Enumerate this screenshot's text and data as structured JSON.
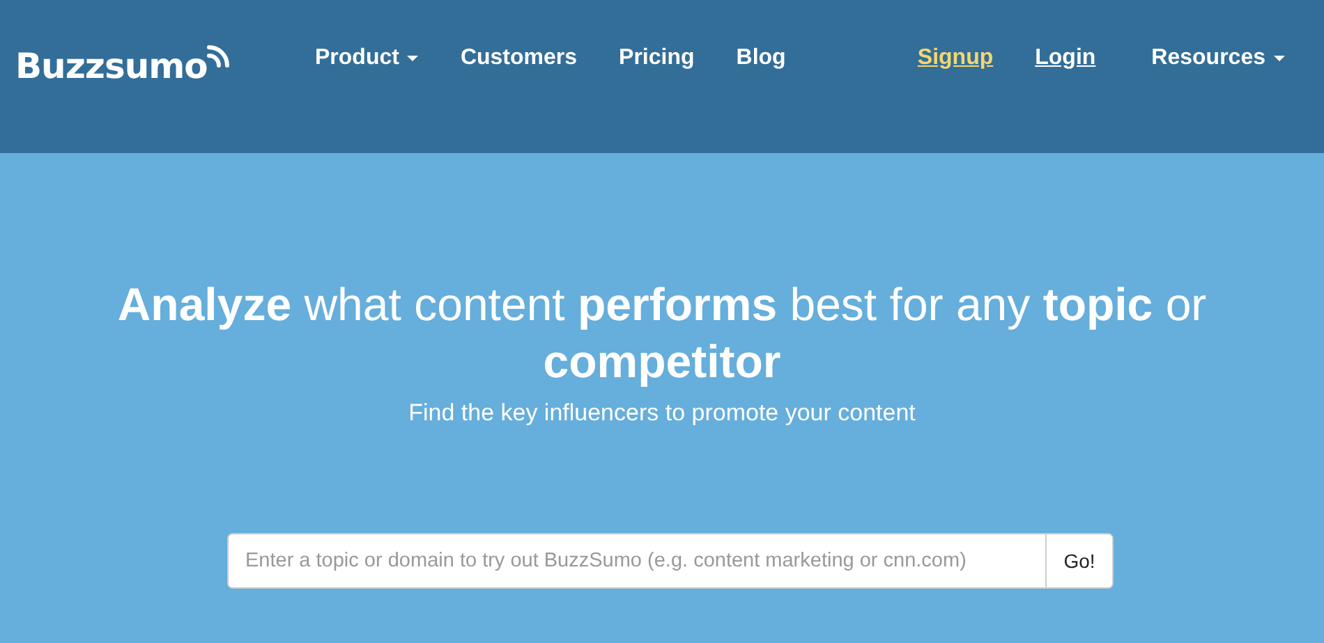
{
  "logo": {
    "text": "Buzzsumo"
  },
  "nav": [
    {
      "label": "Product",
      "kind": "dropdown",
      "highlighted": false
    },
    {
      "label": "Customers",
      "kind": "item",
      "highlighted": false
    },
    {
      "label": "Pricing",
      "kind": "item",
      "highlighted": false
    },
    {
      "label": "Blog",
      "kind": "item",
      "highlighted": false
    }
  ],
  "account_links": [
    {
      "label": "Signup",
      "kind": "link",
      "highlighted": true
    },
    {
      "label": "Login",
      "kind": "link",
      "highlighted": false
    },
    {
      "label": "Resources",
      "kind": "dropdown",
      "highlighted": false
    }
  ],
  "hero": {
    "headline": "**Analyze** what content **performs** best for any **topic** or **competitor**",
    "subtitle": "Find the key influencers to promote your content"
  },
  "search": {
    "placeholder": "Enter a topic or domain to try out BuzzSumo (e.g. content marketing or cnn.com)",
    "button": "Go!"
  }
}
